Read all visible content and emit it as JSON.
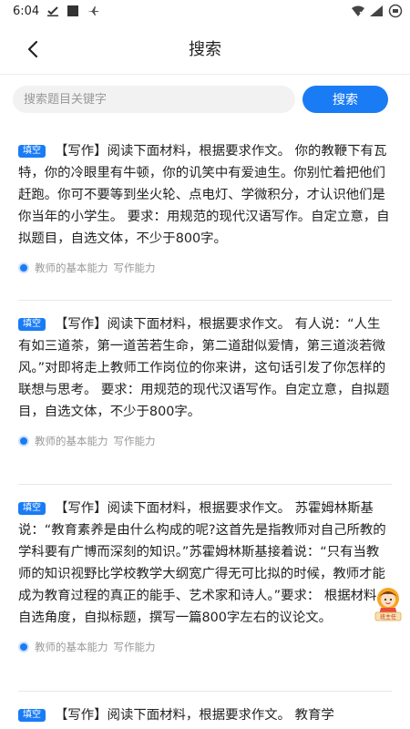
{
  "status_bar": {
    "time": "6:04",
    "left_icons": [
      "download-check-icon",
      "square-icon",
      "airplane-mode-icon"
    ],
    "right_icons": [
      "wifi-x-icon",
      "signal-icon",
      "battery-icon"
    ]
  },
  "header": {
    "title": "搜索"
  },
  "search": {
    "placeholder": "搜索题目关键字",
    "value": "",
    "button_label": "搜索"
  },
  "colors": {
    "accent": "#1a7cf5",
    "meta_text": "#999999"
  },
  "questions": [
    {
      "tag": "填空",
      "text": "【写作】阅读下面材料，根据要求作文。 你的教鞭下有瓦特，你的冷眼里有牛顿，你的讥笑中有爱迪生。你别忙着把他们赶跑。你可不要等到坐火轮、点电灯、学微积分，才认识他们是你当年的小学生。 要求：用规范的现代汉语写作。自定立意，自拟题目，自选文体，不少于800字。",
      "categories": [
        "教师的基本能力",
        "写作能力"
      ]
    },
    {
      "tag": "填空",
      "text": "【写作】阅读下面材料，根据要求作文。 有人说：“人生有如三道茶，第一道苦若生命，第二道甜似爱情，第三道淡若微风。”对即将走上教师工作岗位的你来讲，这句话引发了你怎样的联想与思考。 要求：用规范的现代汉语写作。自定立意，自拟题目，自选文体，不少于800字。",
      "categories": [
        "教师的基本能力",
        "写作能力"
      ]
    },
    {
      "tag": "填空",
      "text": "【写作】阅读下面材料，根据要求作文。 苏霍姆林斯基说：“教育素养是由什么构成的呢?这首先是指教师对自己所教的学科要有广博而深刻的知识。”苏霍姆林斯基接着说：“只有当教师的知识视野比学校教学大纲宽广得无可比拟的时候，教师才能成为教育过程的真正的能手、艺术家和诗人。”要求： 根据材料，自选角度，自拟标题，撰写一篇800字左右的议论文。",
      "categories": [
        "教师的基本能力",
        "写作能力"
      ]
    },
    {
      "tag": "填空",
      "text": "【写作】阅读下面材料，根据要求作文。 教育学"
    }
  ],
  "mascot": {
    "label": "班主任"
  }
}
